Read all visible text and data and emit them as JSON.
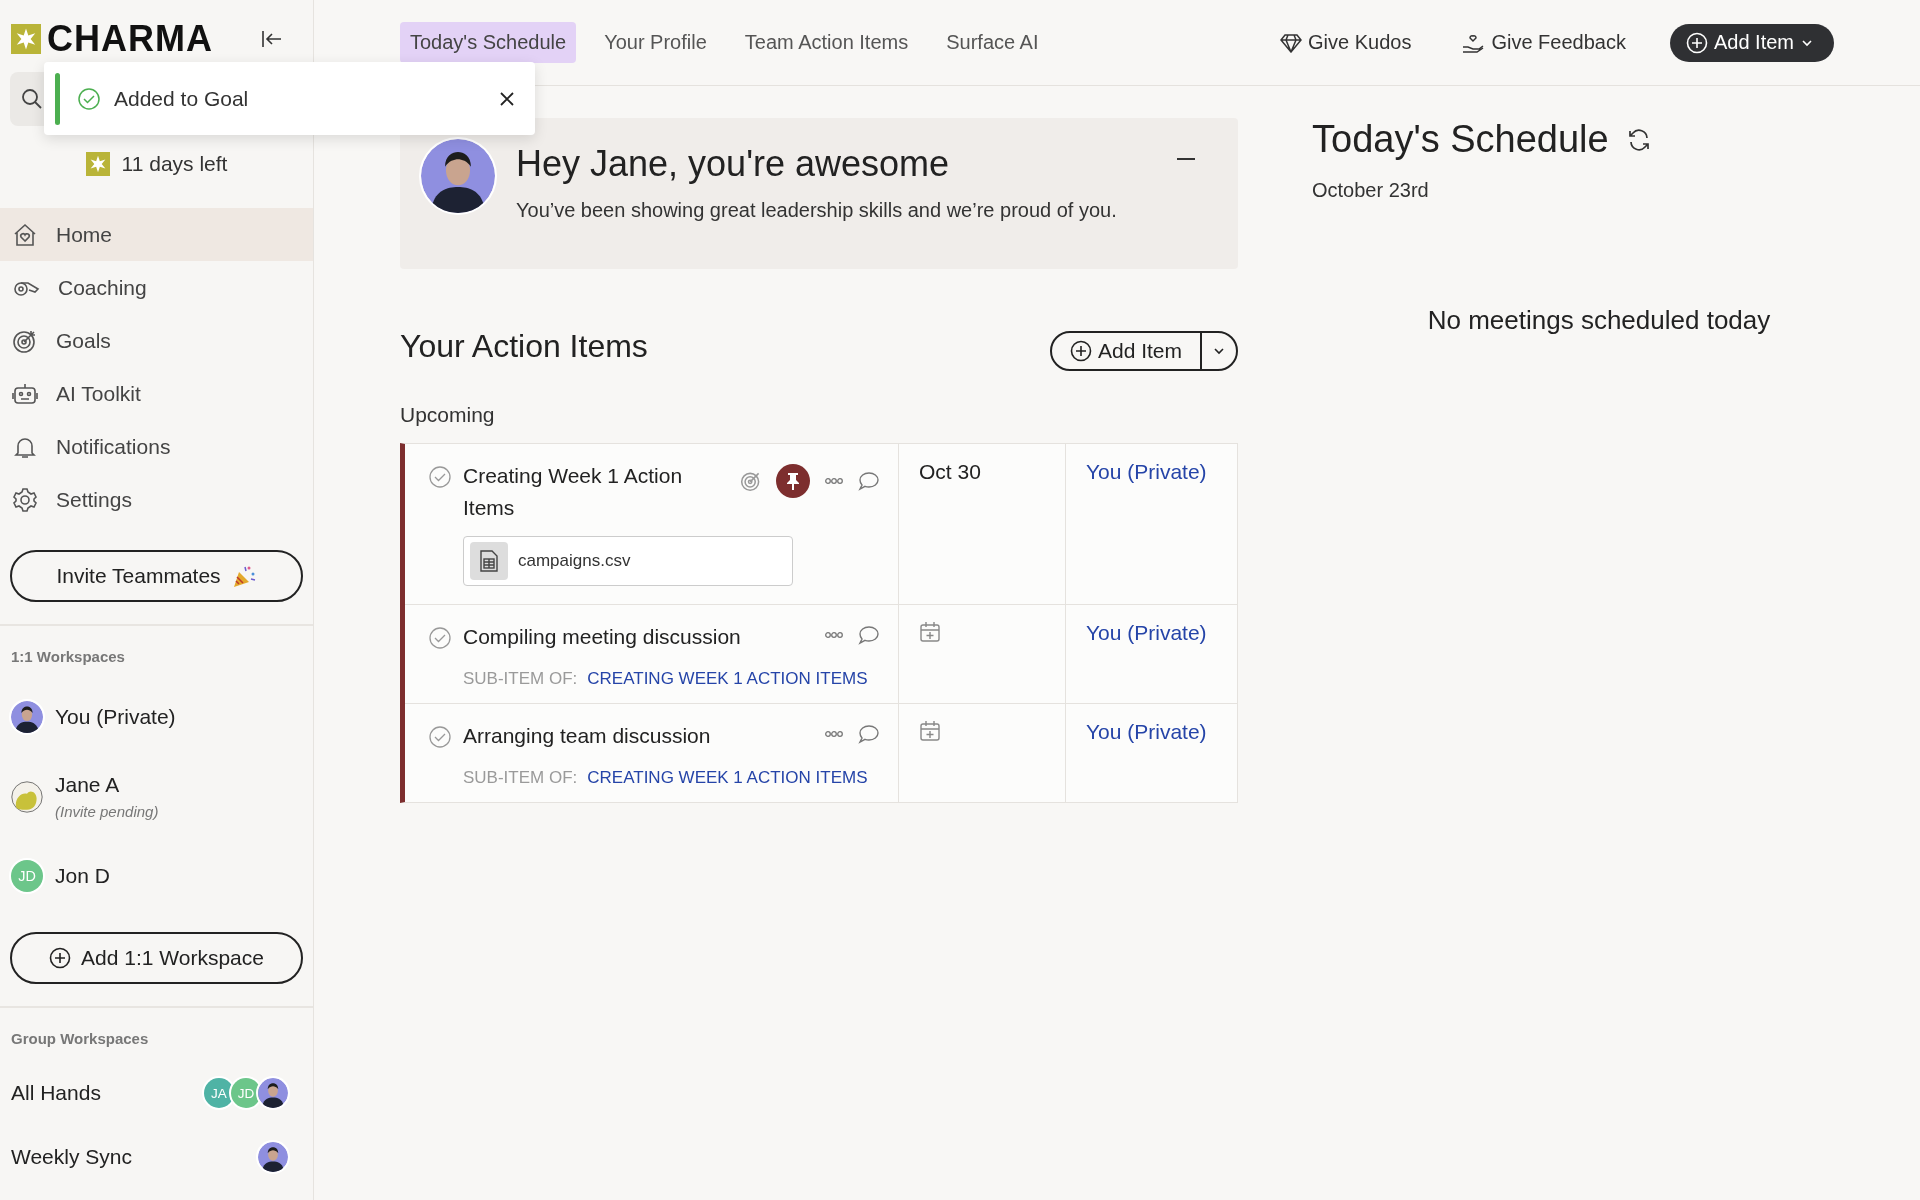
{
  "sidebar": {
    "logo": "CHARMA",
    "trial": "11 days left",
    "nav": [
      {
        "label": "Home",
        "selected": true
      },
      {
        "label": "Coaching",
        "selected": false
      },
      {
        "label": "Goals",
        "selected": false
      },
      {
        "label": "AI Toolkit",
        "selected": false
      },
      {
        "label": "Notifications",
        "selected": false
      },
      {
        "label": "Settings",
        "selected": false
      }
    ],
    "invite_button": "Invite Teammates",
    "one_on_one": {
      "heading": "1:1 Workspaces",
      "items": [
        {
          "name": "You (Private)",
          "avatar": {
            "kind": "photo"
          }
        },
        {
          "name": "Jane A",
          "note": "(Invite pending)",
          "avatar": {
            "kind": "illustration"
          }
        },
        {
          "name": "Jon D",
          "avatar": {
            "kind": "initials",
            "initials": "JD",
            "color": "#6cc68a"
          }
        }
      ],
      "add_button": "Add 1:1 Workspace"
    },
    "groups": {
      "heading": "Group Workspaces",
      "items": [
        {
          "name": "All Hands",
          "members": [
            {
              "kind": "initials",
              "initials": "JA",
              "color": "#4fb3a5"
            },
            {
              "kind": "initials",
              "initials": "JD",
              "color": "#6cc68a"
            },
            {
              "kind": "photo"
            }
          ]
        },
        {
          "name": "Weekly Sync",
          "members": [
            {
              "kind": "photo"
            }
          ]
        }
      ]
    }
  },
  "toast": {
    "message": "Added to Goal"
  },
  "tabs": [
    {
      "label": "Today's Schedule",
      "selected": true
    },
    {
      "label": "Your Profile",
      "selected": false
    },
    {
      "label": "Team Action Items",
      "selected": false
    },
    {
      "label": "Surface AI",
      "selected": false
    }
  ],
  "actions": [
    {
      "label": "Give Kudos",
      "kind": "kudos"
    },
    {
      "label": "Give Feedback",
      "kind": "feedback"
    },
    {
      "label": "Add Item",
      "kind": "primary"
    }
  ],
  "greeting": {
    "title": "Hey Jane, you're awesome",
    "message": "You’ve been showing great leadership skills and we’re proud of you."
  },
  "action_items": {
    "title": "Your Action Items",
    "add_button": "Add Item",
    "section": "Upcoming",
    "rows": [
      {
        "title": "Creating Week 1 Action Items",
        "done": false,
        "goal_linked": true,
        "pinned": true,
        "attachment": "campaigns.csv",
        "due": "Oct 30",
        "owner": "You (Private)"
      },
      {
        "title": "Compiling meeting discussion",
        "done": false,
        "goal_linked": false,
        "pinned": false,
        "parent_label": "SUB-ITEM OF:",
        "parent": "CREATING WEEK 1 ACTION ITEMS",
        "owner": "You (Private)"
      },
      {
        "title": "Arranging team discussion",
        "done": false,
        "goal_linked": false,
        "pinned": false,
        "parent_label": "SUB-ITEM OF:",
        "parent": "CREATING WEEK 1 ACTION ITEMS",
        "owner": "You (Private)"
      }
    ]
  },
  "schedule": {
    "title": "Today's Schedule",
    "date": "October 23rd",
    "empty": "No meetings scheduled today"
  }
}
